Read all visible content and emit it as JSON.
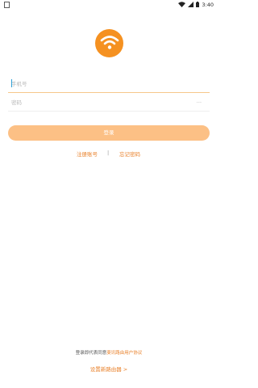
{
  "status_bar": {
    "time": "3:40",
    "icons": [
      "sim-icon",
      "wifi-icon",
      "signal-icon",
      "battery-icon"
    ]
  },
  "logo": {
    "icon": "wifi-icon",
    "color": "#f59121"
  },
  "form": {
    "phone_placeholder": "手机号",
    "password_placeholder": "密码",
    "password_toggle": "---"
  },
  "login_button": {
    "label": "登录",
    "color": "#fcc085"
  },
  "links": {
    "register": "注册账号",
    "separator": "|",
    "forgot": "忘记密码"
  },
  "agreement": {
    "prefix": "登录即代表同意",
    "link": "斐讯路由用户协议"
  },
  "setup": {
    "label": "设置新路由器 >"
  },
  "colors": {
    "accent": "#e9822c",
    "logo": "#f59121",
    "button": "#fcc085"
  }
}
